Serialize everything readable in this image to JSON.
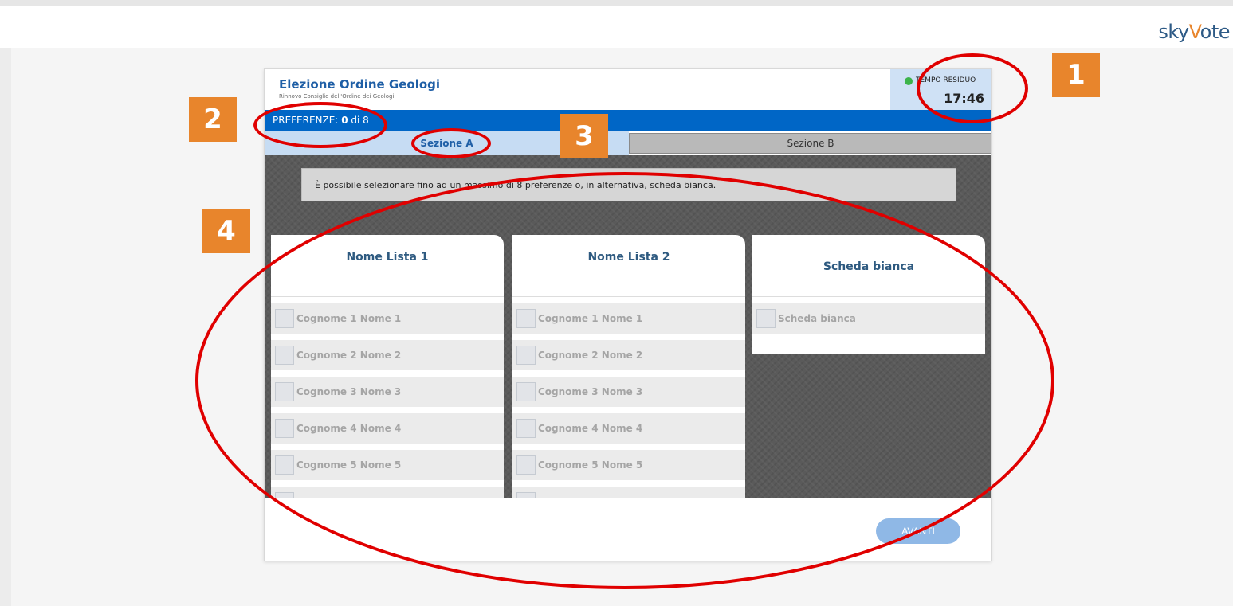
{
  "brand": {
    "logo_a": "sky",
    "logo_b": "V",
    "logo_c": "ote"
  },
  "header": {
    "title": "Elezione Ordine Geologi",
    "subtitle": "Rinnovo Consiglio dell'Ordine dei Geologi"
  },
  "timer": {
    "label": "TEMPO RESIDUO",
    "value": "17:46",
    "status_color": "#3cb44a"
  },
  "preferences": {
    "label": "PREFERENZE:",
    "count": "0",
    "of": "di 8"
  },
  "tabs": [
    {
      "label": "Sezione A",
      "active": true
    },
    {
      "label": "Sezione B",
      "active": false
    }
  ],
  "notice": "È possibile selezionare fino ad un massimo di 8 preferenze o, in alternativa, scheda bianca.",
  "lists": [
    {
      "title": "Nome Lista 1",
      "candidates": [
        "Cognome 1 Nome 1",
        "Cognome 2 Nome 2",
        "Cognome 3 Nome 3",
        "Cognome 4 Nome 4",
        "Cognome 5 Nome 5"
      ]
    },
    {
      "title": "Nome Lista 2",
      "candidates": [
        "Cognome 1 Nome 1",
        "Cognome 2 Nome 2",
        "Cognome 3 Nome 3",
        "Cognome 4 Nome 4",
        "Cognome 5 Nome 5"
      ]
    },
    {
      "title": "Scheda bianca",
      "candidates": [
        "Scheda bianca"
      ]
    }
  ],
  "footer": {
    "next_label": "AVANTI"
  },
  "annotations": {
    "b1": "1",
    "b2": "2",
    "b3": "3",
    "b4": "4",
    "color_ring": "#e00000",
    "color_badge": "#e8852c"
  },
  "colors": {
    "primary": "#0066c6",
    "tab_active": "#c6dcf3",
    "title": "#1f5fa6"
  }
}
